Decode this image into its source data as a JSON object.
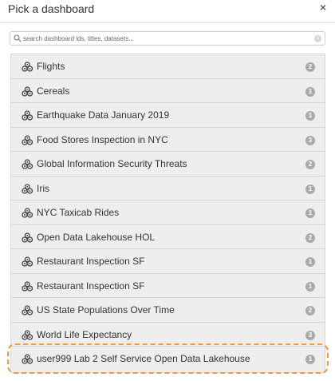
{
  "dialog": {
    "title": "Pick a dashboard",
    "close_glyph": "×"
  },
  "search": {
    "placeholder": "search dashboard ids, titles, datasets...",
    "value": ""
  },
  "dashboards": [
    {
      "label": "Flights",
      "count": "2"
    },
    {
      "label": "Cereals",
      "count": "1"
    },
    {
      "label": "Earthquake Data January 2019",
      "count": "1"
    },
    {
      "label": "Food Stores Inspection in NYC",
      "count": "3"
    },
    {
      "label": "Global Information Security Threats",
      "count": "2"
    },
    {
      "label": "Iris",
      "count": "1"
    },
    {
      "label": "NYC Taxicab Rides",
      "count": "1"
    },
    {
      "label": "Open Data Lakehouse HOL",
      "count": "2"
    },
    {
      "label": "Restaurant Inspection SF",
      "count": "1"
    },
    {
      "label": "Restaurant Inspection SF",
      "count": "1"
    },
    {
      "label": "US State Populations Over Time",
      "count": "2"
    },
    {
      "label": "World Life Expectancy",
      "count": "3"
    },
    {
      "label": "user999 Lab 2 Self Service Open Data Lakehouse",
      "count": "1"
    }
  ],
  "item_icon": "dashboard-cogs-icon",
  "colors": {
    "badge": "#aaaaaa",
    "highlight": "#f29b3a",
    "list_bg": "#eeeeee"
  }
}
